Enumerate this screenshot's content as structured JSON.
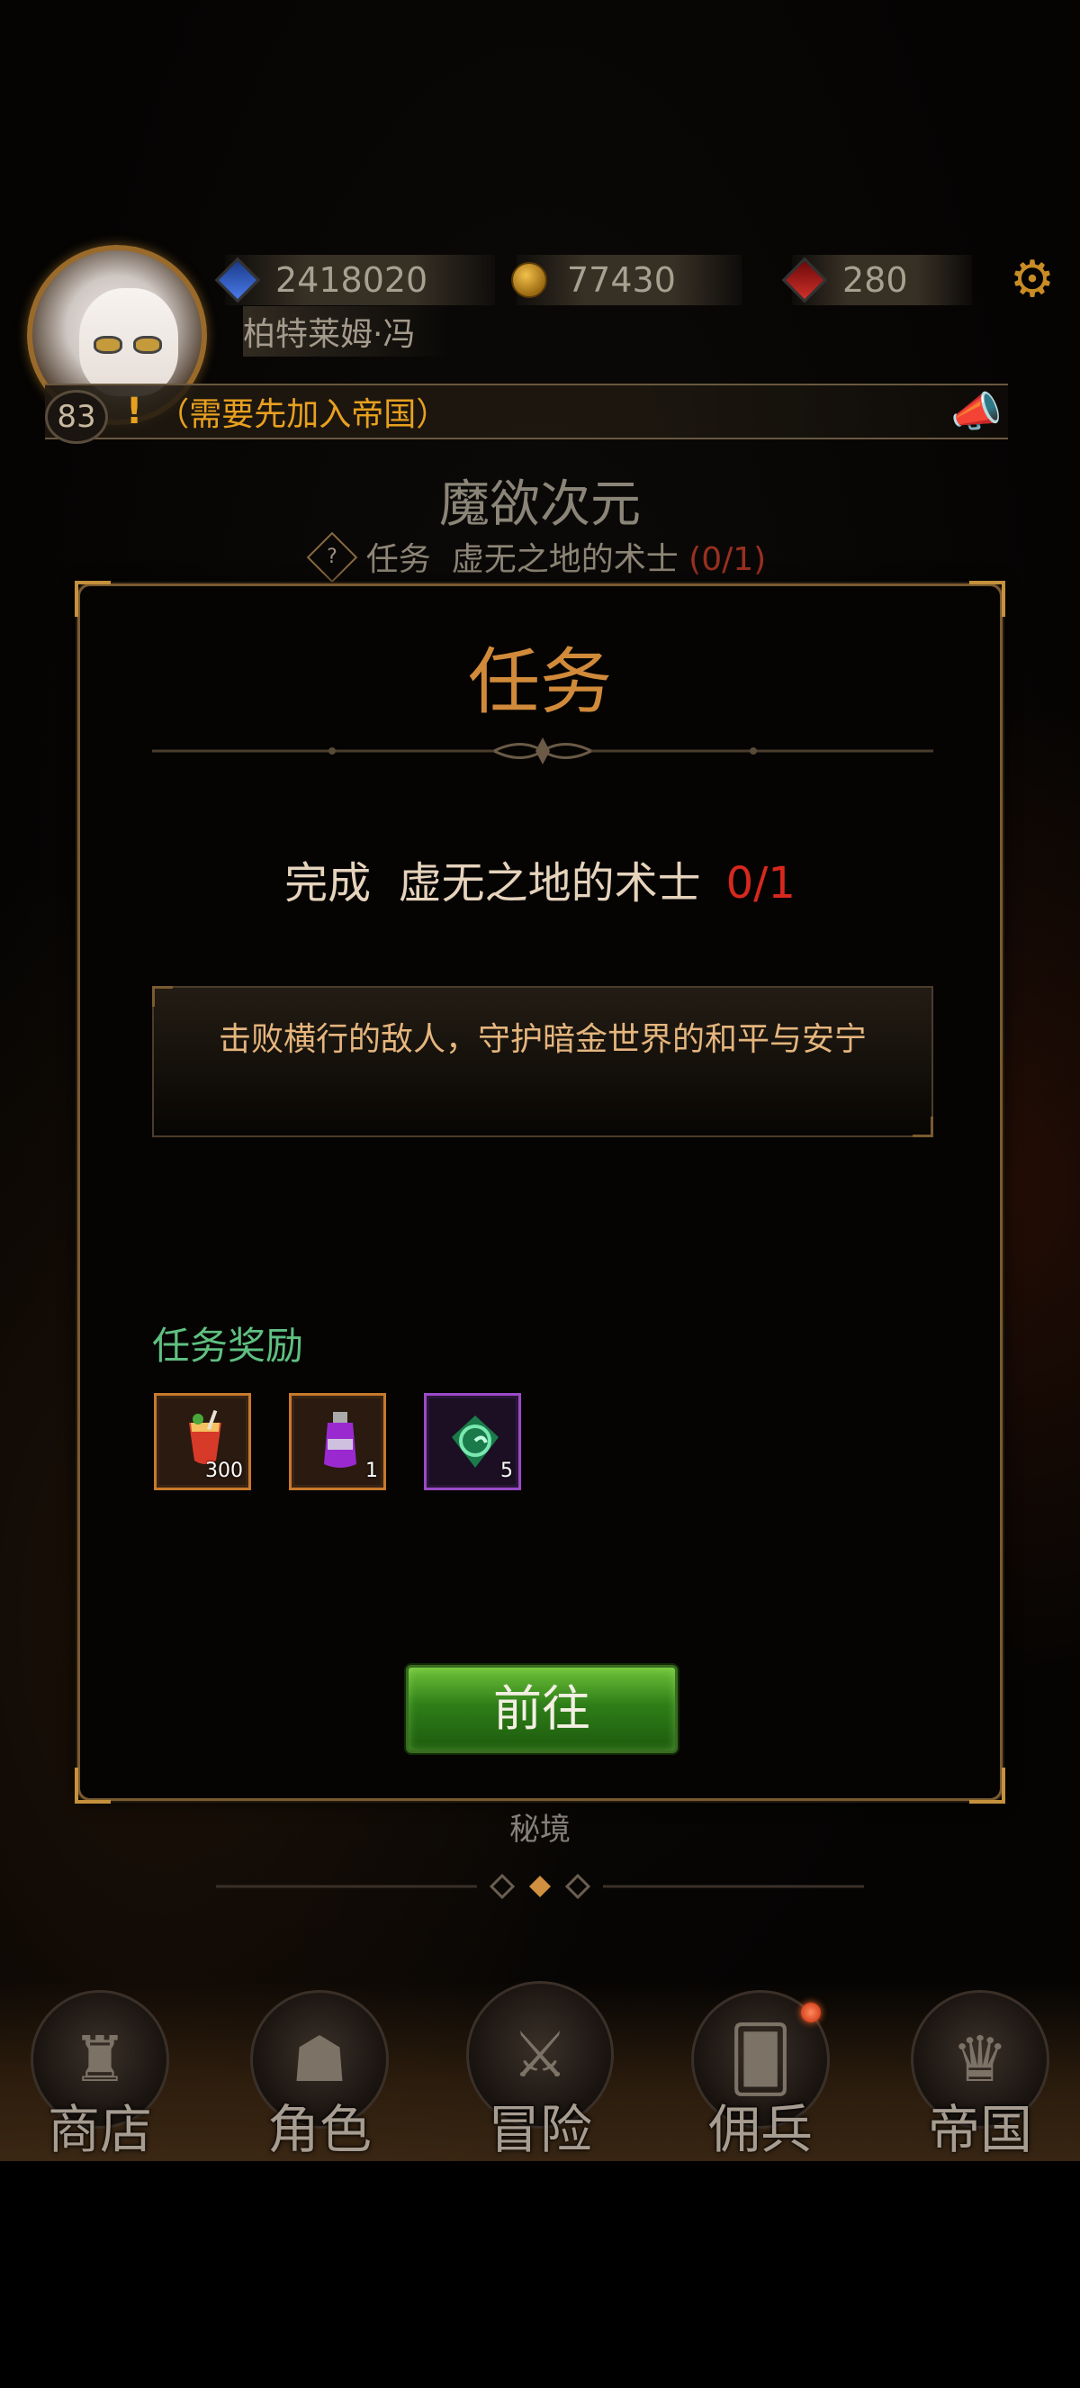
{
  "player": {
    "name": "柏特莱姆·冯",
    "level": "83"
  },
  "resources": [
    {
      "icon": "blue-gem-icon",
      "value": "2418020"
    },
    {
      "icon": "gold-coin-icon",
      "value": "77430"
    },
    {
      "icon": "red-gem-icon",
      "value": "280"
    }
  ],
  "notice": {
    "mark": "!",
    "text": "（需要先加入帝国）"
  },
  "world": {
    "title": "魔欲次元",
    "quest_prefix": "任务",
    "quest_name": "虚无之地的术士",
    "quest_progress": "(0/1)"
  },
  "dialog": {
    "title": "任务",
    "goal_prefix": "完成",
    "goal_name": "虚无之地的术士",
    "goal_count": "0/1",
    "description": "击败横行的敌人，守护暗金世界的和平与安宁",
    "reward_label": "任务奖励",
    "rewards": [
      {
        "icon": "red-cocktail-icon",
        "qty": "300",
        "rarity": "orange"
      },
      {
        "icon": "purple-potion-icon",
        "qty": "1",
        "rarity": "orange"
      },
      {
        "icon": "green-swirl-stone-icon",
        "qty": "5",
        "rarity": "purple"
      }
    ],
    "go_button": "前往"
  },
  "below_label": "秘境",
  "nav": [
    {
      "label": "商店",
      "icon": "castle-icon"
    },
    {
      "label": "角色",
      "icon": "hooded-figure-icon"
    },
    {
      "label": "冒险",
      "icon": "crossed-swords-icon"
    },
    {
      "label": "佣兵",
      "icon": "mercenary-card-icon",
      "badge": true
    },
    {
      "label": "帝国",
      "icon": "crown-icon"
    }
  ],
  "colors": {
    "accent_orange": "#e8a020",
    "title_orange": "#d08a3a",
    "reward_green": "#5fc080",
    "progress_red": "#d8281e",
    "button_green": "#2e7e18"
  }
}
